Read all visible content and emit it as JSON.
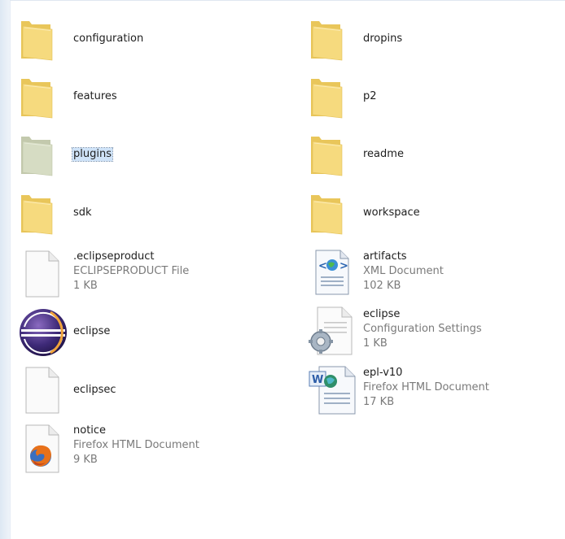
{
  "folders": [
    {
      "name": "configuration"
    },
    {
      "name": "dropins"
    },
    {
      "name": "features"
    },
    {
      "name": "p2"
    },
    {
      "name": "plugins",
      "selected": true
    },
    {
      "name": "readme"
    },
    {
      "name": "sdk"
    },
    {
      "name": "workspace"
    }
  ],
  "files": [
    {
      "name": ".eclipseproduct",
      "type": "ECLIPSEPRODUCT File",
      "size": "1 KB",
      "icon": "blank-file-icon"
    },
    {
      "name": "artifacts",
      "type": "XML Document",
      "size": "102 KB",
      "icon": "xml-document-icon"
    },
    {
      "name": "eclipse",
      "icon": "eclipse-app-icon"
    },
    {
      "name": "eclipse",
      "type": "Configuration Settings",
      "size": "1 KB",
      "icon": "config-settings-icon"
    },
    {
      "name": "eclipsec",
      "icon": "blank-file-icon"
    },
    {
      "name": "epl-v10",
      "type": "Firefox HTML Document",
      "size": "17 KB",
      "icon": "word-html-document-icon"
    },
    {
      "name": "notice",
      "type": "Firefox HTML Document",
      "size": "9 KB",
      "icon": "firefox-document-icon"
    }
  ],
  "colors": {
    "folder": "#f5d978",
    "folder_selected": "#d6dcc3",
    "selection": "#cfe3f8"
  }
}
